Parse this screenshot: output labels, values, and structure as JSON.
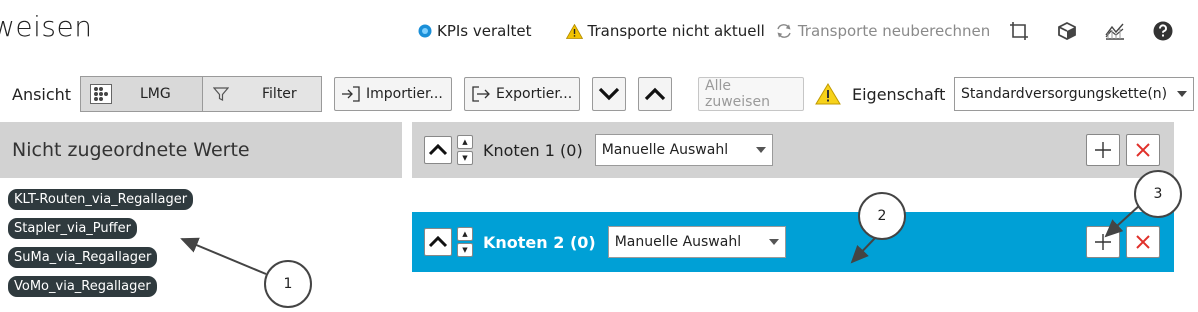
{
  "header": {
    "title": "weisen",
    "kpi_status": "KPIs veraltet",
    "transport_warning": "Transporte nicht aktuell",
    "recalc_label": "Transporte neuberechnen",
    "icons": [
      "crop-icon",
      "cube-icon",
      "chart-icon",
      "help-icon"
    ]
  },
  "toolbar": {
    "view_label": "Ansicht",
    "lmg_label": "LMG",
    "filter_label": "Filter",
    "import_label": "Importier...",
    "export_label": "Exportier...",
    "assign_all_label": "Alle zuweisen",
    "property_label": "Eigenschaft",
    "property_value": "Standardversorgungskette(n)"
  },
  "left_panel": {
    "title": "Nicht zugeordnete Werte",
    "items": [
      "KLT-Routen_via_Regallager",
      "Stapler_via_Puffer",
      "SuMa_via_Regallager",
      "VoMo_via_Regallager"
    ]
  },
  "nodes": [
    {
      "label": "Knoten 1 (0)",
      "selection": "Manuelle Auswahl",
      "active": false
    },
    {
      "label": "Knoten 2 (0)",
      "selection": "Manuelle Auswahl",
      "active": true
    }
  ],
  "callouts": [
    "1",
    "2",
    "3"
  ],
  "colors": {
    "accent": "#00a0d6",
    "panel": "#d2d2d2",
    "tag_bg": "#2f3a3e",
    "delete": "#e0302a",
    "warning": "#f2c200"
  }
}
